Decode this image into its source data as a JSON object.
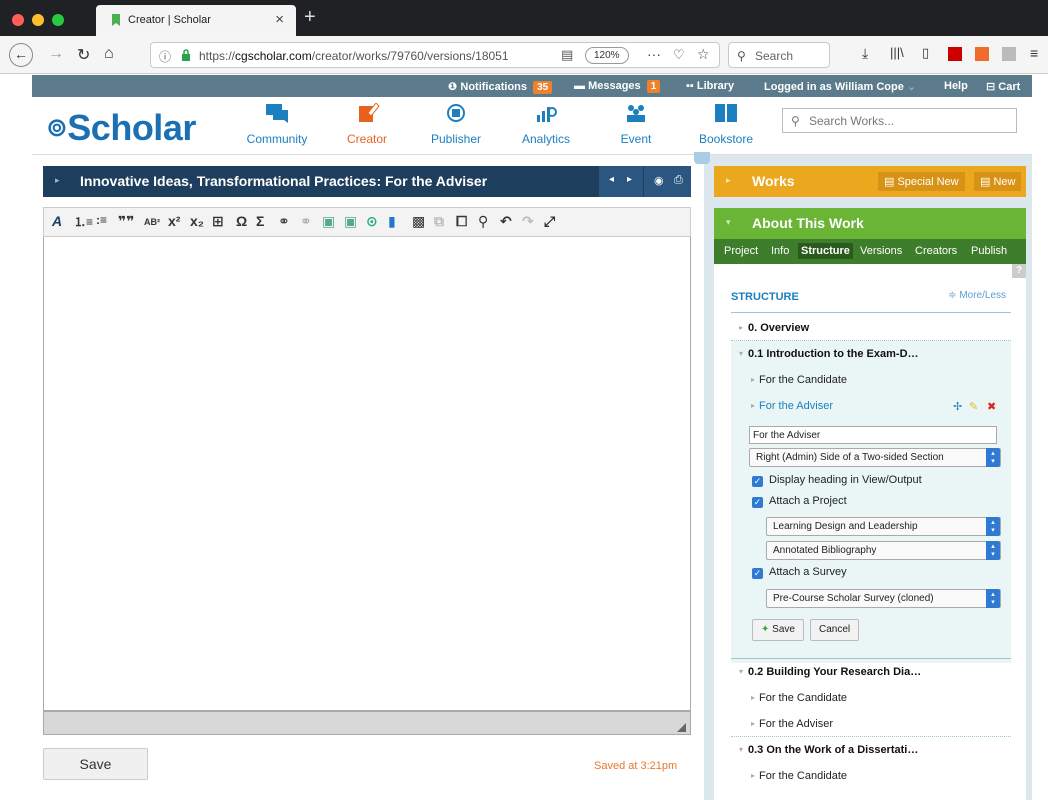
{
  "browser": {
    "tab_title": "Creator | Scholar",
    "url_prefix": "https://",
    "url_domain": "cgscholar.com",
    "url_path": "/creator/works/79760/versions/18051",
    "zoom": "120%",
    "search_placeholder": "Search"
  },
  "topbar": {
    "notifications_label": "Notifications",
    "notifications_count": "35",
    "messages_label": "Messages",
    "messages_count": "1",
    "library_label": "Library",
    "logged_in": "Logged in as William Cope",
    "help": "Help",
    "cart": "Cart"
  },
  "header": {
    "logo": "Scholar",
    "nav": [
      {
        "label": "Community",
        "color": "#1b7fc0"
      },
      {
        "label": "Creator",
        "color": "#e8621e"
      },
      {
        "label": "Publisher",
        "color": "#1b7fc0"
      },
      {
        "label": "Analytics",
        "color": "#1b7fc0"
      },
      {
        "label": "Event",
        "color": "#1b7fc0"
      },
      {
        "label": "Bookstore",
        "color": "#1b7fc0"
      }
    ],
    "search_placeholder": "Search Works..."
  },
  "editor": {
    "title": "Innovative Ideas, Transformational Practices: For the Adviser",
    "save_label": "Save",
    "saved_status": "Saved at 3:21pm"
  },
  "works": {
    "title": "Works",
    "special_new": "Special New",
    "new": "New"
  },
  "about": {
    "title": "About This Work",
    "tabs": [
      "Project",
      "Info",
      "Structure",
      "Versions",
      "Creators",
      "Publish"
    ],
    "active_tab": "Structure",
    "help": "?"
  },
  "structure": {
    "label": "STRUCTURE",
    "more_less": "More/Less",
    "items": [
      {
        "label": "0. Overview"
      },
      {
        "label": "0.1 Introduction to the Exam-D…"
      },
      {
        "label": "For the Candidate"
      },
      {
        "label": "For the Adviser"
      },
      {
        "label": "0.2 Building Your Research Dia…"
      },
      {
        "label": "For the Candidate"
      },
      {
        "label": "For the Adviser"
      },
      {
        "label": "0.3 On the Work of a Dissertati…"
      },
      {
        "label": "For the Candidate"
      }
    ],
    "editor_form": {
      "name_value": "For the Adviser",
      "side_select": "Right (Admin) Side of a Two-sided Section",
      "display_heading": "Display heading in View/Output",
      "attach_project": "Attach a Project",
      "project_select": "Learning Design and Leadership",
      "project_sub_select": "Annotated Bibliography",
      "attach_survey": "Attach a Survey",
      "survey_select": "Pre-Course Scholar Survey (cloned)",
      "save": "Save",
      "cancel": "Cancel"
    }
  }
}
